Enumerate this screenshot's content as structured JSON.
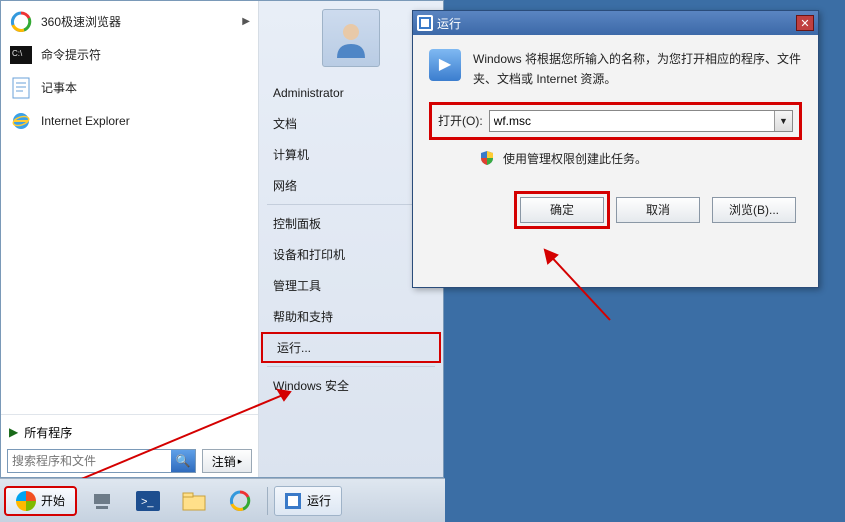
{
  "start_menu": {
    "apps": [
      {
        "label": "360极速浏览器",
        "icon": "browser360-icon",
        "has_sub": true
      },
      {
        "label": "命令提示符",
        "icon": "cmd-icon",
        "has_sub": false
      },
      {
        "label": "记事本",
        "icon": "notepad-icon",
        "has_sub": false
      },
      {
        "label": "Internet Explorer",
        "icon": "ie-icon",
        "has_sub": false
      }
    ],
    "all_programs": "所有程序",
    "search_placeholder": "搜索程序和文件",
    "logout": "注销",
    "right": {
      "username": "Administrator",
      "items_top": [
        "文档",
        "计算机",
        "网络"
      ],
      "items_mid": [
        "控制面板",
        "设备和打印机",
        "管理工具",
        "帮助和支持"
      ],
      "run": "运行...",
      "security": "Windows 安全"
    }
  },
  "run_dialog": {
    "title": "运行",
    "description": "Windows 将根据您所输入的名称，为您打开相应的程序、文件夹、文档或 Internet 资源。",
    "open_label": "打开(O):",
    "command": "wf.msc",
    "admin_note": "使用管理权限创建此任务。",
    "buttons": {
      "ok": "确定",
      "cancel": "取消",
      "browse": "浏览(B)..."
    }
  },
  "taskbar": {
    "start": "开始",
    "run_task": "运行"
  }
}
